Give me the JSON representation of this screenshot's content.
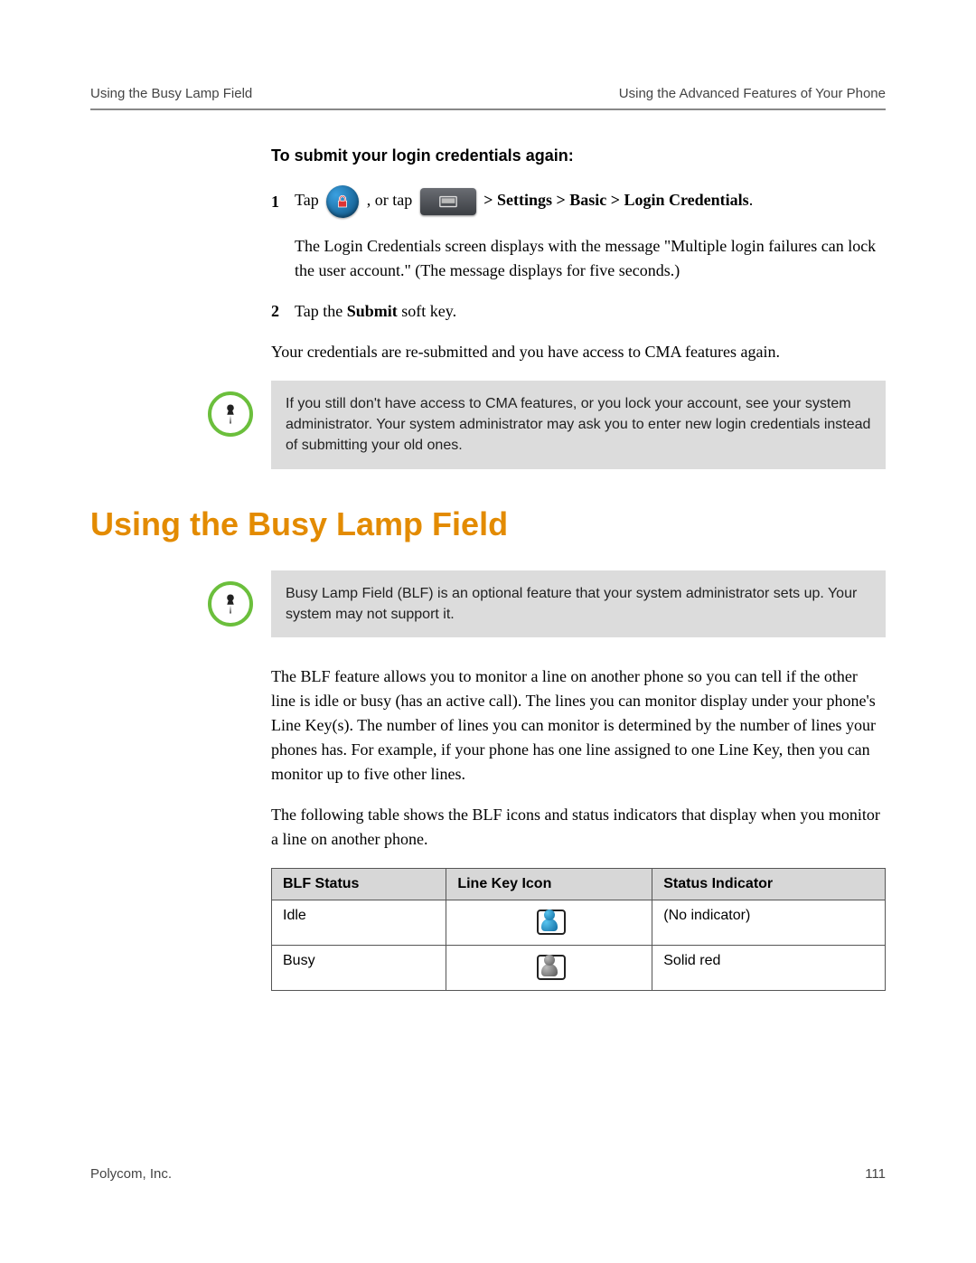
{
  "header": {
    "left": "Using the Busy Lamp Field",
    "right": "Using the Advanced Features of Your Phone"
  },
  "proc": {
    "subhead": "To submit your login credentials again:",
    "step1_tap": "Tap",
    "step1_or_tap": " , or tap ",
    "step1_path": " > Settings > Basic > Login Credentials",
    "step1_period": ".",
    "step1_result": "The Login Credentials screen displays with the message \"Multiple login failures can lock the user account.\" (The message displays for five seconds.)",
    "step2_a": "Tap the ",
    "step2_b": "Submit",
    "step2_c": " soft key.",
    "result": "Your credentials are re-submitted and you have access to CMA features again."
  },
  "note1": "If you still don't have access to CMA features, or you lock your account, see your system administrator. Your system administrator may ask you to enter new login credentials instead of submitting your old ones.",
  "section_title": "Using the Busy Lamp Field",
  "note2": "Busy Lamp Field (BLF) is an optional feature that your system administrator sets up. Your system may not support it.",
  "body1": "The BLF feature allows you to monitor a line on another phone so you can tell if the other line is idle or busy (has an active call). The lines you can monitor display under your phone's Line Key(s). The number of lines you can monitor is determined by the number of lines your phones has. For example, if your phone has one line assigned to one Line Key, then you can monitor up to five other lines.",
  "body2": "The following table shows the BLF icons and status indicators that display when you monitor a line on another phone.",
  "table": {
    "headers": [
      "BLF Status",
      "Line Key Icon",
      "Status Indicator"
    ],
    "rows": [
      {
        "status": "Idle",
        "icon": "blue",
        "indicator": "(No indicator)"
      },
      {
        "status": "Busy",
        "icon": "grey",
        "indicator": "Solid red"
      }
    ]
  },
  "footer": {
    "left": "Polycom, Inc.",
    "right": "111"
  }
}
